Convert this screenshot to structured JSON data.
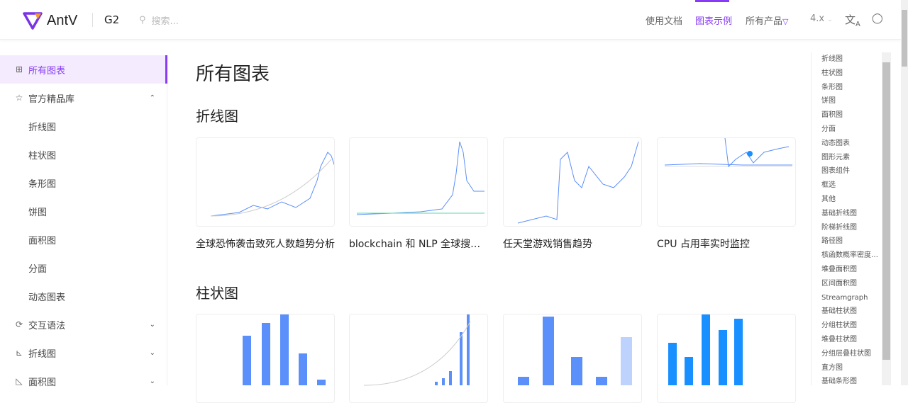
{
  "header": {
    "logo": "AntV",
    "product": "G2",
    "search_placeholder": "搜索...",
    "nav": [
      "使用文档",
      "图表示例",
      "所有产品"
    ],
    "version": "4.x",
    "accent": "#873bf4"
  },
  "sidebar": {
    "items": [
      {
        "label": "所有图表",
        "icon": "grid-icon",
        "active": true
      },
      {
        "label": "官方精品库",
        "icon": "star-icon",
        "expanded": true
      },
      {
        "label": "折线图",
        "sub": true
      },
      {
        "label": "柱状图",
        "sub": true
      },
      {
        "label": "条形图",
        "sub": true
      },
      {
        "label": "饼图",
        "sub": true
      },
      {
        "label": "面积图",
        "sub": true
      },
      {
        "label": "分面",
        "sub": true
      },
      {
        "label": "动态图表",
        "sub": true
      },
      {
        "label": "交互语法",
        "icon": "sync-icon"
      },
      {
        "label": "折线图",
        "icon": "line-chart-icon"
      },
      {
        "label": "面积图",
        "icon": "area-chart-icon"
      }
    ]
  },
  "main": {
    "title": "所有图表",
    "sections": [
      {
        "title": "折线图",
        "cards": [
          "全球恐怖袭击致死人数趋势分析",
          "blockchain 和 NLP 全球搜索趋势",
          "任天堂游戏销售趋势",
          "CPU 占用率实时监控"
        ]
      },
      {
        "title": "柱状图",
        "cards": [
          "",
          "",
          "",
          ""
        ]
      }
    ]
  },
  "anchors": [
    "折线图",
    "柱状图",
    "条形图",
    "饼图",
    "面积图",
    "分面",
    "动态图表",
    "图形元素",
    "图表组件",
    "框选",
    "其他",
    "基础折线图",
    "阶梯折线图",
    "路径图",
    "核函数概率密度估计",
    "堆叠面积图",
    "区间面积图",
    "Streamgraph",
    "基础柱状图",
    "分组柱状图",
    "堆叠柱状图",
    "分组层叠柱状图",
    "直方图",
    "基础条形图"
  ]
}
